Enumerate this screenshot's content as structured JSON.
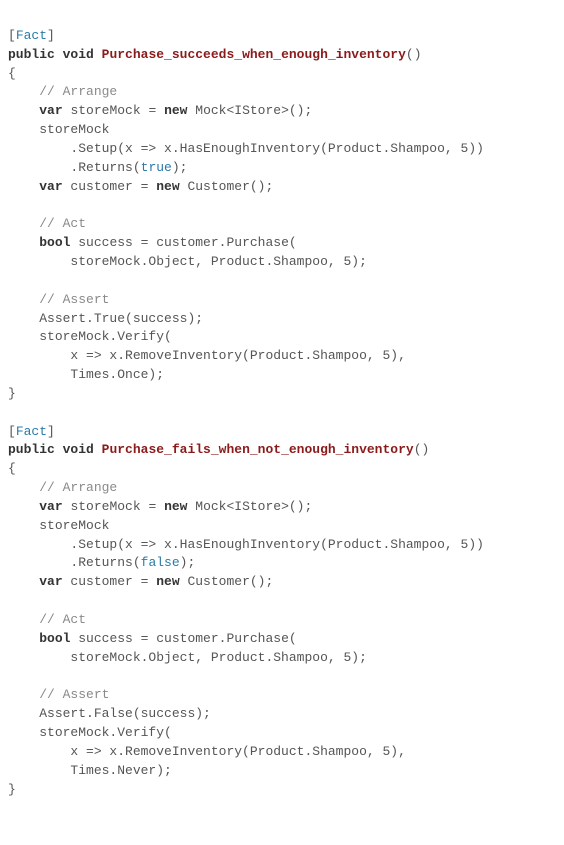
{
  "tests": [
    {
      "attribute": "Fact",
      "modifiers": "public void",
      "name": "Purchase_succeeds_when_enough_inventory",
      "arrangeComment": "// Arrange",
      "mockDecl1": "var",
      "mockDecl2": "storeMock = ",
      "newKw": "new",
      "mockType": " Mock<IStore>();",
      "setupLine1": "storeMock",
      "setupLine2": ".Setup(x => x.HasEnoughInventory(Product.Shampoo, ",
      "setupNum": "5",
      "setupLine2b": "))",
      "returnsPrefix": ".Returns(",
      "returnsVal": "true",
      "returnsSuffix": ");",
      "custDecl1": "var",
      "custDecl2": " customer = ",
      "custType": " Customer();",
      "actComment": "// Act",
      "boolKw": "bool",
      "actLine1": " success = customer.Purchase(",
      "actLine2": "storeMock.Object, Product.Shampoo, ",
      "actNum": "5",
      "actLine2b": ");",
      "assertComment": "// Assert",
      "assertLine": "Assert.True(success);",
      "verifyLine1": "storeMock.Verify(",
      "verifyLine2": "x => x.RemoveInventory(Product.Shampoo, ",
      "verifyNum": "5",
      "verifyLine2b": "),",
      "verifyLine3": "Times.Once);"
    },
    {
      "attribute": "Fact",
      "modifiers": "public void",
      "name": "Purchase_fails_when_not_enough_inventory",
      "arrangeComment": "// Arrange",
      "mockDecl1": "var",
      "mockDecl2": "storeMock = ",
      "newKw": "new",
      "mockType": " Mock<IStore>();",
      "setupLine1": "storeMock",
      "setupLine2": ".Setup(x => x.HasEnoughInventory(Product.Shampoo, ",
      "setupNum": "5",
      "setupLine2b": "))",
      "returnsPrefix": ".Returns(",
      "returnsVal": "false",
      "returnsSuffix": ");",
      "custDecl1": "var",
      "custDecl2": " customer = ",
      "custType": " Customer();",
      "actComment": "// Act",
      "boolKw": "bool",
      "actLine1": " success = customer.Purchase(",
      "actLine2": "storeMock.Object, Product.Shampoo, ",
      "actNum": "5",
      "actLine2b": ");",
      "assertComment": "// Assert",
      "assertLine": "Assert.False(success);",
      "verifyLine1": "storeMock.Verify(",
      "verifyLine2": "x => x.RemoveInventory(Product.Shampoo, ",
      "verifyNum": "5",
      "verifyLine2b": "),",
      "verifyLine3": "Times.Never);"
    }
  ]
}
